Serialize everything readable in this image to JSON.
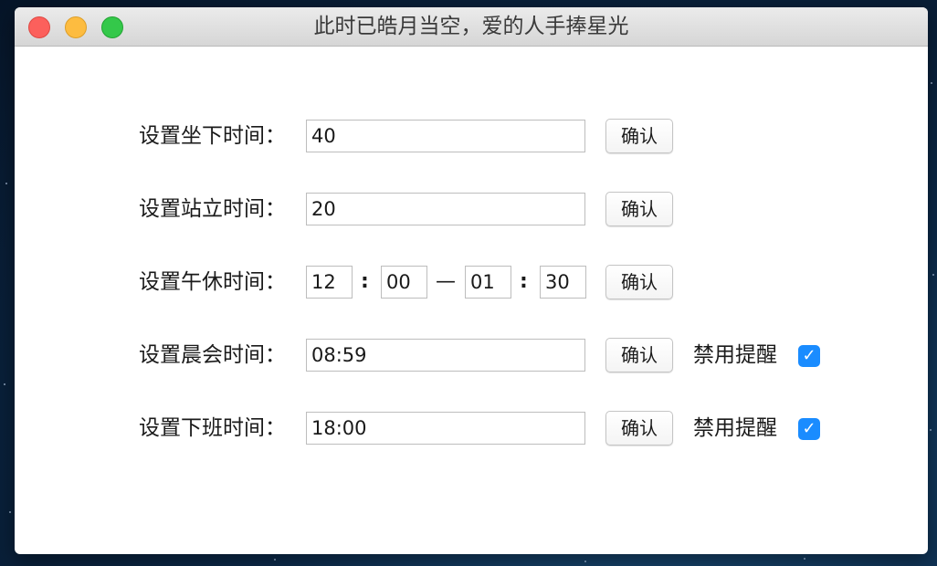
{
  "window": {
    "title": "此时已皓月当空，爱的人手捧星光"
  },
  "form": {
    "sit": {
      "label": "设置坐下时间：",
      "value": "40",
      "confirm": "确认"
    },
    "stand": {
      "label": "设置站立时间：",
      "value": "20",
      "confirm": "确认"
    },
    "lunch": {
      "label": "设置午休时间：",
      "start_hour": "12",
      "start_minute": "00",
      "end_hour": "01",
      "end_minute": "30",
      "colon": ":",
      "dash": "—",
      "confirm": "确认"
    },
    "morning_meeting": {
      "label": "设置晨会时间：",
      "value": "08:59",
      "confirm": "确认",
      "disable_label": "禁用提醒",
      "disabled_checked": true
    },
    "off_work": {
      "label": "设置下班时间：",
      "value": "18:00",
      "confirm": "确认",
      "disable_label": "禁用提醒",
      "disabled_checked": true
    }
  },
  "icons": {
    "checkmark": "✓"
  },
  "colors": {
    "close": "#fc605c",
    "minimize": "#fdbc40",
    "zoom": "#34c84a",
    "checkbox": "#1a8cff"
  }
}
